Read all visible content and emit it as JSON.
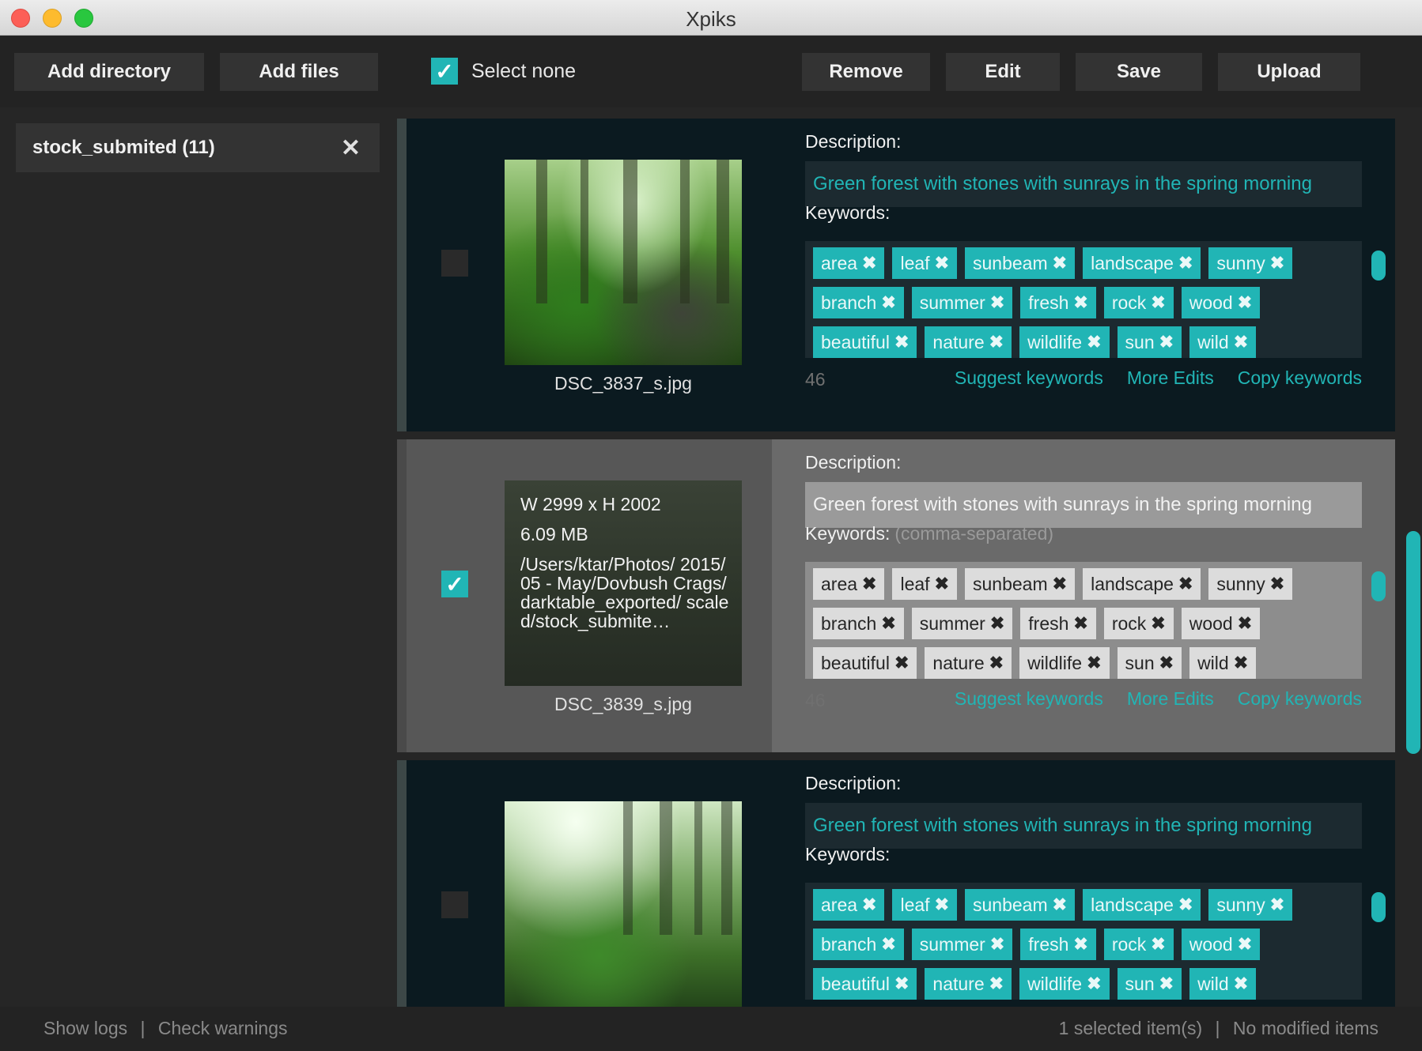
{
  "window": {
    "title": "Xpiks"
  },
  "toolbar": {
    "add_directory": "Add directory",
    "add_files": "Add files",
    "select_none": "Select none",
    "remove": "Remove",
    "edit": "Edit",
    "save": "Save",
    "upload": "Upload"
  },
  "sidebar": {
    "directories": [
      {
        "label": "stock_submited (11)"
      }
    ]
  },
  "items": [
    {
      "selected": false,
      "filename": "DSC_3837_s.jpg",
      "description_label": "Description:",
      "description": "Green forest with stones with sunrays in the spring morning",
      "keywords_label": "Keywords:",
      "keywords_hint": "",
      "keywords": [
        [
          "area",
          "leaf",
          "sunbeam",
          "landscape",
          "sunny"
        ],
        [
          "branch",
          "summer",
          "fresh",
          "rock",
          "wood"
        ],
        [
          "beautiful",
          "nature",
          "wildlife",
          "sun",
          "wild"
        ]
      ],
      "keyword_count": "46",
      "links": {
        "suggest": "Suggest keywords",
        "more": "More Edits",
        "copy": "Copy keywords"
      }
    },
    {
      "selected": true,
      "filename": "DSC_3839_s.jpg",
      "meta": {
        "dimensions": "W 2999 x H 2002",
        "size": "6.09 MB",
        "path": "/Users/ktar/Photos/ 2015/05 - May/Dovbush Crags/ darktable_exported/ scaled/stock_submite…"
      },
      "description_label": "Description:",
      "description": "Green forest with stones with sunrays in the spring morning",
      "keywords_label": "Keywords:",
      "keywords_hint": "(comma-separated)",
      "keywords": [
        [
          "area",
          "leaf",
          "sunbeam",
          "landscape",
          "sunny"
        ],
        [
          "branch",
          "summer",
          "fresh",
          "rock",
          "wood"
        ],
        [
          "beautiful",
          "nature",
          "wildlife",
          "sun",
          "wild"
        ]
      ],
      "keyword_count": "46",
      "links": {
        "suggest": "Suggest keywords",
        "more": "More Edits",
        "copy": "Copy keywords"
      }
    },
    {
      "selected": false,
      "filename": "",
      "description_label": "Description:",
      "description": "Green forest with stones with sunrays in the spring morning",
      "keywords_label": "Keywords:",
      "keywords_hint": "",
      "keywords": [
        [
          "area",
          "leaf",
          "sunbeam",
          "landscape",
          "sunny"
        ],
        [
          "branch",
          "summer",
          "fresh",
          "rock",
          "wood"
        ],
        [
          "beautiful",
          "nature",
          "wildlife",
          "sun",
          "wild"
        ]
      ],
      "keyword_count": "",
      "links": {
        "suggest": "",
        "more": "",
        "copy": ""
      }
    }
  ],
  "statusbar": {
    "show_logs": "Show logs",
    "separator": "|",
    "check_warnings": "Check warnings",
    "selected": "1 selected item(s)",
    "modified": "No modified items"
  },
  "colors": {
    "accent": "#21b5b5",
    "background": "#262626",
    "item_dark": "#0b1a20",
    "item_selected": "#6a6a6a"
  },
  "icons": {
    "checkbox_checked": "checkmark-icon",
    "remove_keyword": "close-icon",
    "remove_directory": "close-icon"
  }
}
